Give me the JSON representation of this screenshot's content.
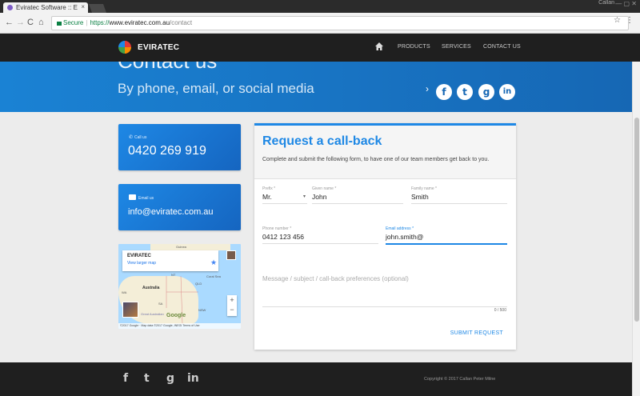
{
  "browser": {
    "tab_title": "Eviratec Software :: E",
    "tab_close": "×",
    "window_user": "Callan",
    "window_controls": "— ▢ ✕",
    "nav_back": "←",
    "nav_forward": "→",
    "nav_reload": "C",
    "nav_home": "⌂",
    "secure_label": "Secure",
    "url_scheme": "https://",
    "url_host": "www.eviratec.com.au",
    "url_path": "/contact",
    "bookmark_star": "☆",
    "menu": "⋮"
  },
  "site": {
    "logo_text": "EVIRATEC",
    "nav": [
      "PRODUCTS",
      "SERVICES",
      "CONTACT US"
    ]
  },
  "hero": {
    "heading": "Contact us",
    "subheading": "By phone, email, or social media",
    "chevron": "›",
    "social": [
      "f",
      "t",
      "g",
      "in"
    ]
  },
  "contact": {
    "phone_label": "Call us",
    "phone": "0420 269 919",
    "email_label": "Email us",
    "email": "info@eviratec.com.au"
  },
  "map": {
    "title": "EVIRATEC",
    "link": "View larger map",
    "labels": [
      "Guinea",
      "NT",
      "Coral Sea",
      "QLD",
      "Australia",
      "WA",
      "SA",
      "NSW",
      "Great Australian"
    ],
    "zoom_in": "+",
    "zoom_out": "−",
    "google": "Google",
    "footer": "©2017 Google · Map data ©2017 Google, INEGI  Terms of Use"
  },
  "form": {
    "title": "Request a call-back",
    "description": "Complete and submit the following form, to have one of our team members get back to you.",
    "prefix_label": "Prefix *",
    "prefix_value": "Mr.",
    "given_label": "Given name *",
    "given_value": "John",
    "family_label": "Family name *",
    "family_value": "Smith",
    "phone_label": "Phone number *",
    "phone_value": "0412 123 456",
    "email_label": "Email address *",
    "email_value": "john.smith@",
    "message_placeholder": "Message / subject / call-back preferences (optional)",
    "counter": "0 / 500",
    "submit": "SUBMIT REQUEST"
  },
  "footer": {
    "social": [
      "f",
      "t",
      "g",
      "in"
    ],
    "copyright": "Copyright © 2017 Callan Peter Milne"
  },
  "colors": {
    "accent": "#1e88e5",
    "nav_bg": "#1f1f1f",
    "hero": "#1667b4"
  }
}
